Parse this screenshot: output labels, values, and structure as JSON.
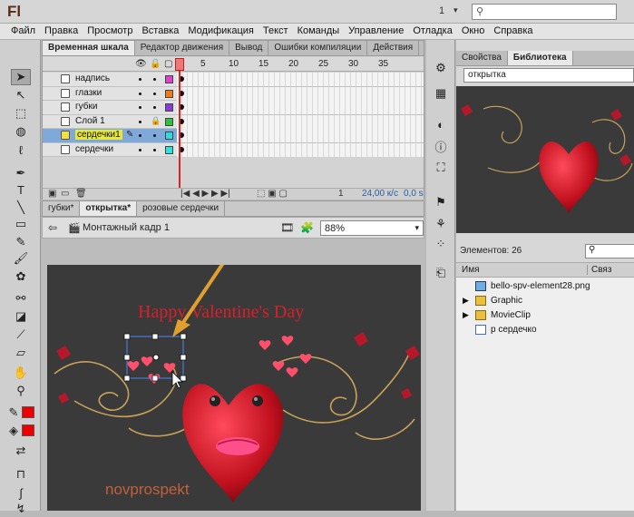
{
  "titlebar": {
    "logo": "Fl",
    "workspace_num": "1",
    "search_value": ""
  },
  "menu": [
    "Файл",
    "Правка",
    "Просмотр",
    "Вставка",
    "Модификация",
    "Текст",
    "Команды",
    "Управление",
    "Отладка",
    "Окно",
    "Справка"
  ],
  "timeline_tabs": [
    "Временная шкала",
    "Редактор движения",
    "Вывод",
    "Ошибки компиляции",
    "Действия"
  ],
  "frame_numbers": [
    "1",
    "5",
    "10",
    "15",
    "20",
    "25",
    "30",
    "35"
  ],
  "layers": [
    {
      "name": "надпись",
      "color": "#e040d0"
    },
    {
      "name": "глазки",
      "color": "#ee7a18"
    },
    {
      "name": "губки",
      "color": "#8a3ad8"
    },
    {
      "name": "Слой 1",
      "color": "#30c040"
    },
    {
      "name": "сердечки1",
      "color": "#30d8e0"
    },
    {
      "name": "сердечки",
      "color": "#30e0e0"
    }
  ],
  "timeline_footer": {
    "frame": "1",
    "fps": "24,00 к/с",
    "time": "0,0 s"
  },
  "doc_tabs": [
    "губки*",
    "открытка*",
    "розовые сердечки"
  ],
  "edit_bar": {
    "scene_label": "Монтажный кадр 1",
    "zoom": "88%"
  },
  "stage": {
    "title_text": "Happy Valentine's Day",
    "watermark": "novprospekt"
  },
  "right_tabs": [
    "Свойства",
    "Библиотека"
  ],
  "library": {
    "selected_doc": "открытка",
    "count_label": "Элементов: 26",
    "col_name": "Имя",
    "col_link": "Связ",
    "items": [
      {
        "label": "bello-spv-element28.png",
        "icon": "bitmap-icon",
        "expandable": false
      },
      {
        "label": "Graphic",
        "icon": "folder-icon",
        "expandable": true
      },
      {
        "label": "MovieClip",
        "icon": "folder-icon",
        "expandable": true
      },
      {
        "label": "р сердечко",
        "icon": "symbol-icon",
        "expandable": false
      }
    ]
  },
  "colors": {
    "stroke": "#e00000",
    "fill": "#e00000",
    "stage_bg": "#3a3a3a",
    "arrow": "#e0a030"
  }
}
